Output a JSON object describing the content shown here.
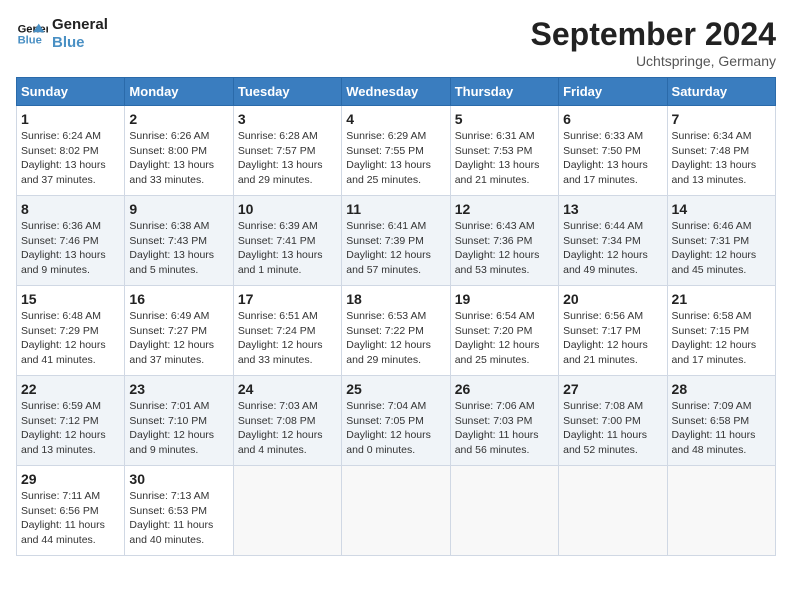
{
  "header": {
    "logo_line1": "General",
    "logo_line2": "Blue",
    "month": "September 2024",
    "location": "Uchtspringe, Germany"
  },
  "days_of_week": [
    "Sunday",
    "Monday",
    "Tuesday",
    "Wednesday",
    "Thursday",
    "Friday",
    "Saturday"
  ],
  "weeks": [
    [
      {
        "day": 1,
        "rise": "6:24 AM",
        "set": "8:02 PM",
        "hours": "13 hours",
        "mins": "37 minutes"
      },
      {
        "day": 2,
        "rise": "6:26 AM",
        "set": "8:00 PM",
        "hours": "13 hours",
        "mins": "33 minutes"
      },
      {
        "day": 3,
        "rise": "6:28 AM",
        "set": "7:57 PM",
        "hours": "13 hours",
        "mins": "29 minutes"
      },
      {
        "day": 4,
        "rise": "6:29 AM",
        "set": "7:55 PM",
        "hours": "13 hours",
        "mins": "25 minutes"
      },
      {
        "day": 5,
        "rise": "6:31 AM",
        "set": "7:53 PM",
        "hours": "13 hours",
        "mins": "21 minutes"
      },
      {
        "day": 6,
        "rise": "6:33 AM",
        "set": "7:50 PM",
        "hours": "13 hours",
        "mins": "17 minutes"
      },
      {
        "day": 7,
        "rise": "6:34 AM",
        "set": "7:48 PM",
        "hours": "13 hours",
        "mins": "13 minutes"
      }
    ],
    [
      {
        "day": 8,
        "rise": "6:36 AM",
        "set": "7:46 PM",
        "hours": "13 hours",
        "mins": "9 minutes"
      },
      {
        "day": 9,
        "rise": "6:38 AM",
        "set": "7:43 PM",
        "hours": "13 hours",
        "mins": "5 minutes"
      },
      {
        "day": 10,
        "rise": "6:39 AM",
        "set": "7:41 PM",
        "hours": "13 hours",
        "mins": "1 minute"
      },
      {
        "day": 11,
        "rise": "6:41 AM",
        "set": "7:39 PM",
        "hours": "12 hours",
        "mins": "57 minutes"
      },
      {
        "day": 12,
        "rise": "6:43 AM",
        "set": "7:36 PM",
        "hours": "12 hours",
        "mins": "53 minutes"
      },
      {
        "day": 13,
        "rise": "6:44 AM",
        "set": "7:34 PM",
        "hours": "12 hours",
        "mins": "49 minutes"
      },
      {
        "day": 14,
        "rise": "6:46 AM",
        "set": "7:31 PM",
        "hours": "12 hours",
        "mins": "45 minutes"
      }
    ],
    [
      {
        "day": 15,
        "rise": "6:48 AM",
        "set": "7:29 PM",
        "hours": "12 hours",
        "mins": "41 minutes"
      },
      {
        "day": 16,
        "rise": "6:49 AM",
        "set": "7:27 PM",
        "hours": "12 hours",
        "mins": "37 minutes"
      },
      {
        "day": 17,
        "rise": "6:51 AM",
        "set": "7:24 PM",
        "hours": "12 hours",
        "mins": "33 minutes"
      },
      {
        "day": 18,
        "rise": "6:53 AM",
        "set": "7:22 PM",
        "hours": "12 hours",
        "mins": "29 minutes"
      },
      {
        "day": 19,
        "rise": "6:54 AM",
        "set": "7:20 PM",
        "hours": "12 hours",
        "mins": "25 minutes"
      },
      {
        "day": 20,
        "rise": "6:56 AM",
        "set": "7:17 PM",
        "hours": "12 hours",
        "mins": "21 minutes"
      },
      {
        "day": 21,
        "rise": "6:58 AM",
        "set": "7:15 PM",
        "hours": "12 hours",
        "mins": "17 minutes"
      }
    ],
    [
      {
        "day": 22,
        "rise": "6:59 AM",
        "set": "7:12 PM",
        "hours": "12 hours",
        "mins": "13 minutes"
      },
      {
        "day": 23,
        "rise": "7:01 AM",
        "set": "7:10 PM",
        "hours": "12 hours",
        "mins": "9 minutes"
      },
      {
        "day": 24,
        "rise": "7:03 AM",
        "set": "7:08 PM",
        "hours": "12 hours",
        "mins": "4 minutes"
      },
      {
        "day": 25,
        "rise": "7:04 AM",
        "set": "7:05 PM",
        "hours": "12 hours",
        "mins": "0 minutes"
      },
      {
        "day": 26,
        "rise": "7:06 AM",
        "set": "7:03 PM",
        "hours": "11 hours",
        "mins": "56 minutes"
      },
      {
        "day": 27,
        "rise": "7:08 AM",
        "set": "7:00 PM",
        "hours": "11 hours",
        "mins": "52 minutes"
      },
      {
        "day": 28,
        "rise": "7:09 AM",
        "set": "6:58 PM",
        "hours": "11 hours",
        "mins": "48 minutes"
      }
    ],
    [
      {
        "day": 29,
        "rise": "7:11 AM",
        "set": "6:56 PM",
        "hours": "11 hours",
        "mins": "44 minutes"
      },
      {
        "day": 30,
        "rise": "7:13 AM",
        "set": "6:53 PM",
        "hours": "11 hours",
        "mins": "40 minutes"
      },
      null,
      null,
      null,
      null,
      null
    ]
  ]
}
